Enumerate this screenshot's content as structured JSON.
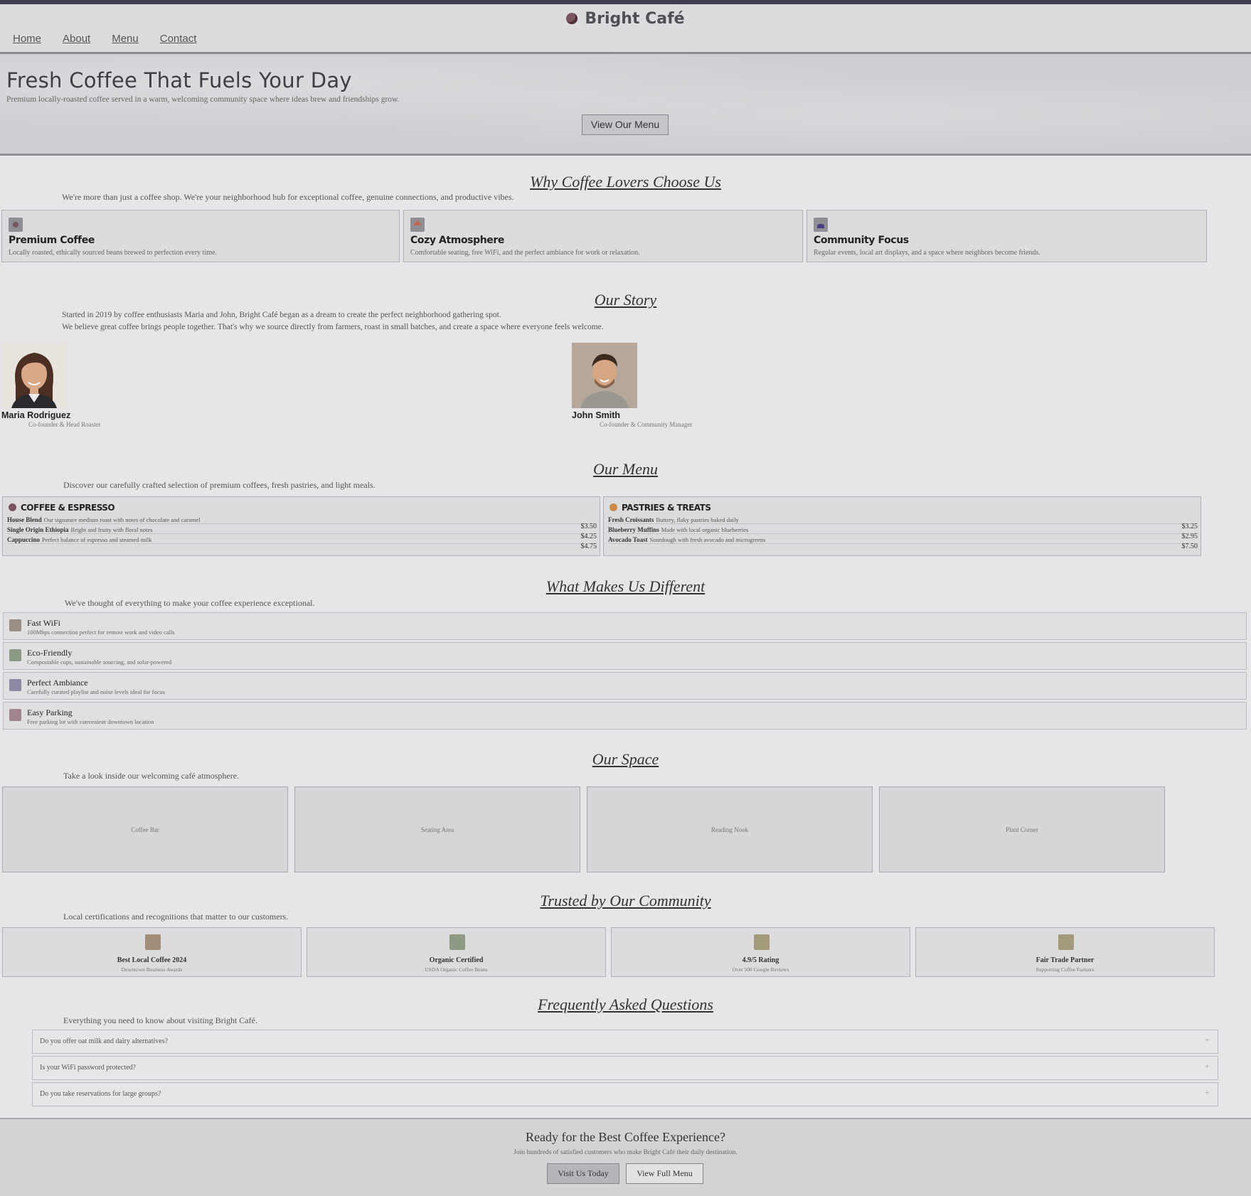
{
  "site": {
    "brand": "Bright Café"
  },
  "nav": [
    "Home",
    "About",
    "Menu",
    "Contact"
  ],
  "hero": {
    "title": "Fresh Coffee That Fuels Your Day",
    "subtitle": "Premium locally-roasted coffee served in a warm, welcoming community space where ideas brew and friendships grow.",
    "button": "View Our Menu"
  },
  "why": {
    "title": "Why Coffee Lovers Choose Us",
    "subtitle": "We're more than just a coffee shop. We're your neighborhood hub for exceptional coffee, genuine connections, and productive vibes.",
    "features": [
      {
        "icon": "coffee-icon",
        "title": "Premium Coffee",
        "desc": "Locally roasted, ethically sourced beans brewed to perfection every time."
      },
      {
        "icon": "home-icon",
        "title": "Cozy Atmosphere",
        "desc": "Comfortable seating, free WiFi, and the perfect ambiance for work or relaxation."
      },
      {
        "icon": "people-icon",
        "title": "Community Focus",
        "desc": "Regular events, local art displays, and a space where neighbors become friends."
      }
    ]
  },
  "story": {
    "title": "Our Story",
    "p1": "Started in 2019 by coffee enthusiasts Maria and John, Bright Café began as a dream to create the perfect neighborhood gathering spot.",
    "p2": "We believe great coffee brings people together. That's why we source directly from farmers, roast in small batches, and create a space where everyone feels welcome.",
    "people": [
      {
        "name": "Maria Rodriguez",
        "role": "Co-founder & Head Roaster"
      },
      {
        "name": "John Smith",
        "role": "Co-founder & Community Manager"
      }
    ]
  },
  "menu": {
    "title": "Our Menu",
    "subtitle": "Discover our carefully crafted selection of premium coffees, fresh pastries, and light meals.",
    "categories": [
      {
        "name": "COFFEE & ESPRESSO",
        "items": [
          {
            "name": "House Blend",
            "desc": "Our signature medium roast with notes of chocolate and caramel"
          },
          {
            "name": "Single Origin Ethiopia",
            "desc": "Bright and fruity with floral notes"
          },
          {
            "name": "Cappuccino",
            "desc": "Perfect balance of espresso and steamed milk"
          }
        ],
        "prices": [
          "$3.50",
          "$4.25",
          "$4.75"
        ]
      },
      {
        "name": "PASTRIES & TREATS",
        "items": [
          {
            "name": "Fresh Croissants",
            "desc": "Buttery, flaky pastries baked daily"
          },
          {
            "name": "Blueberry Muffins",
            "desc": "Made with local organic blueberries"
          },
          {
            "name": "Avocado Toast",
            "desc": "Sourdough with fresh avocado and microgreens"
          }
        ],
        "prices": [
          "$3.25",
          "$2.95",
          "$7.50"
        ]
      }
    ]
  },
  "different": {
    "title": "What Makes Us Different",
    "subtitle": "We've thought of everything to make your coffee experience exceptional.",
    "items": [
      {
        "icon": "wifi-icon",
        "title": "Fast WiFi",
        "desc": "100Mbps connection perfect for remote work and video calls"
      },
      {
        "icon": "leaf-icon",
        "title": "Eco-Friendly",
        "desc": "Compostable cups, sustainable sourcing, and solar-powered"
      },
      {
        "icon": "music-icon",
        "title": "Perfect Ambiance",
        "desc": "Carefully curated playlist and noise levels ideal for focus"
      },
      {
        "icon": "car-icon",
        "title": "Easy Parking",
        "desc": "Free parking lot with convenient downtown location"
      }
    ]
  },
  "space": {
    "title": "Our Space",
    "subtitle": "Take a look inside our welcoming café atmosphere.",
    "tiles": [
      "Coffee Bar",
      "Seating Area",
      "Reading Nook",
      "Plant Corner"
    ]
  },
  "trust": {
    "title": "Trusted by Our Community",
    "subtitle": "Local certifications and recognitions that matter to our customers.",
    "cards": [
      {
        "icon": "trophy-icon",
        "title": "Best Local Coffee 2024",
        "sub": "Downtown Business Awards"
      },
      {
        "icon": "leaf-icon",
        "title": "Organic Certified",
        "sub": "USDA Organic Coffee Beans"
      },
      {
        "icon": "star-icon",
        "title": "4.9/5 Rating",
        "sub": "Over 500 Google Reviews"
      },
      {
        "icon": "handshake-icon",
        "title": "Fair Trade Partner",
        "sub": "Supporting Coffee Farmers"
      }
    ]
  },
  "faq": {
    "title": "Frequently Asked Questions",
    "subtitle": "Everything you need to know about visiting Bright Café.",
    "items": [
      "Do you offer oat milk and dairy alternatives?",
      "Is your WiFi password protected?",
      "Do you take reservations for large groups?"
    ],
    "toggle": "+"
  },
  "cta": {
    "title": "Ready for the Best Coffee Experience?",
    "subtitle": "Join hundreds of satisfied customers who make Bright Café their daily destination.",
    "primary": "Visit Us Today",
    "secondary": "View Full Menu"
  },
  "colors": {
    "topbar": "#3f3d4d",
    "background": "#e6e6e8",
    "accent_coffee": "#7a5560",
    "accent_pastry": "#c98a4a"
  }
}
